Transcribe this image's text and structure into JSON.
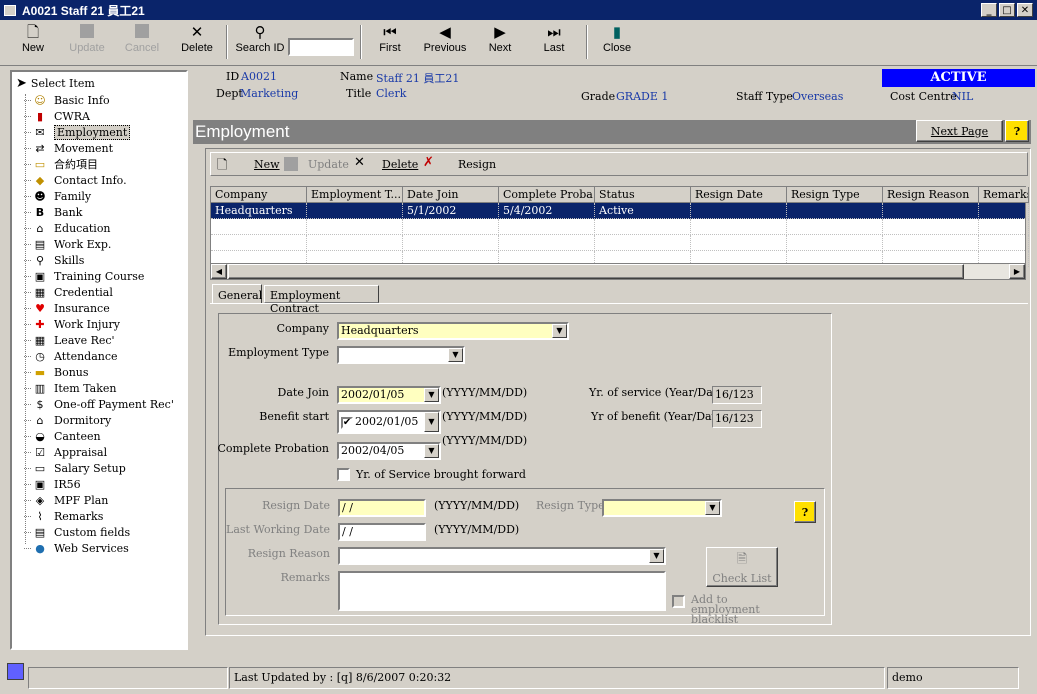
{
  "window": {
    "title": "A0021 Staff 21 員工21",
    "min": "_",
    "max": "□",
    "close": "✕"
  },
  "toolbar": {
    "new": "New",
    "update": "Update",
    "cancel": "Cancel",
    "delete": "Delete",
    "search_id": "Search ID",
    "search_value": "",
    "first": "First",
    "previous": "Previous",
    "next": "Next",
    "last": "Last",
    "close": "Close"
  },
  "sidebar": {
    "header": "Select Item",
    "items": [
      {
        "label": "Basic Info",
        "icon": "person-icon"
      },
      {
        "label": "CWRA",
        "icon": "book-icon"
      },
      {
        "label": "Employment",
        "icon": "envelope-icon"
      },
      {
        "label": "Movement",
        "icon": "move-icon"
      },
      {
        "label": "合約項目",
        "icon": "folder-icon"
      },
      {
        "label": "Contact Info.",
        "icon": "contact-icon"
      },
      {
        "label": "Family",
        "icon": "family-icon"
      },
      {
        "label": "Bank",
        "icon": "bank-icon"
      },
      {
        "label": "Education",
        "icon": "education-icon"
      },
      {
        "label": "Work Exp.",
        "icon": "document-icon"
      },
      {
        "label": "Skills",
        "icon": "skills-icon"
      },
      {
        "label": "Training Course",
        "icon": "training-icon"
      },
      {
        "label": "Credential",
        "icon": "credential-icon"
      },
      {
        "label": "Insurance",
        "icon": "heart-icon"
      },
      {
        "label": "Work Injury",
        "icon": "injury-icon"
      },
      {
        "label": "Leave Rec'",
        "icon": "calendar-icon"
      },
      {
        "label": "Attendance",
        "icon": "clock-icon"
      },
      {
        "label": "Bonus",
        "icon": "bonus-icon"
      },
      {
        "label": "Item Taken",
        "icon": "item-icon"
      },
      {
        "label": "One-off Payment Rec'",
        "icon": "dollar-icon"
      },
      {
        "label": "Dormitory",
        "icon": "dormitory-icon"
      },
      {
        "label": "Canteen",
        "icon": "canteen-icon"
      },
      {
        "label": "Appraisal",
        "icon": "checkbox-icon"
      },
      {
        "label": "Salary Setup",
        "icon": "salary-icon"
      },
      {
        "label": "IR56",
        "icon": "disk-icon"
      },
      {
        "label": "MPF Plan",
        "icon": "plan-icon"
      },
      {
        "label": "Remarks",
        "icon": "paperclip-icon"
      },
      {
        "label": "Custom fields",
        "icon": "custom-icon"
      },
      {
        "label": "Web Services",
        "icon": "globe-icon"
      }
    ]
  },
  "staff": {
    "id_label": "ID",
    "id": "A0021",
    "dept_label": "Dept",
    "dept": "Marketing",
    "name_label": "Name",
    "name": "Staff 21 員工21",
    "title_label": "Title",
    "title": "Clerk",
    "grade_label": "Grade",
    "grade": "GRADE 1",
    "staff_type_label": "Staff Type",
    "staff_type": "Overseas",
    "cost_centre_label": "Cost Centre",
    "cost_centre": "NIL",
    "status": "ACTIVE"
  },
  "section": {
    "title": "Employment",
    "next_page": "Next Page",
    "help": "?"
  },
  "subtoolbar": {
    "new": "New",
    "update": "Update",
    "delete": "Delete",
    "resign": "Resign"
  },
  "grid": {
    "columns": [
      "Company",
      "Employment T...",
      "Date Join",
      "Complete Proba...",
      "Status",
      "Resign Date",
      "Resign Type",
      "Resign Reason",
      "Remarks"
    ],
    "rows": [
      [
        "Headquarters",
        "",
        "5/1/2002",
        "5/4/2002",
        "Active",
        "",
        "",
        "",
        ""
      ]
    ]
  },
  "tabs": {
    "general": "General",
    "contract": "Employment Contract"
  },
  "form": {
    "company_label": "Company",
    "company": "Headquarters",
    "employment_type_label": "Employment Type",
    "employment_type": "",
    "date_join_label": "Date Join",
    "date_join": "2002/01/05",
    "benefit_start_label": "Benefit start",
    "benefit_start": "2002/01/05",
    "complete_probation_label": "Complete Probation",
    "complete_probation": "2002/04/05",
    "date_format": "(YYYY/MM/DD)",
    "yr_service_label": "Yr. of service (Year/Day)",
    "yr_service": "16/123",
    "yr_benefit_label": "Yr of benefit (Year/Day)",
    "yr_benefit": "16/123",
    "brought_forward_label": "Yr. of Service brought forward",
    "resign_date_label": "Resign Date",
    "resign_date": " / /",
    "last_working_label": "Last Working Date",
    "last_working": " / /",
    "resign_type_label": "Resign Type",
    "resign_type": "",
    "resign_reason_label": "Resign Reason",
    "resign_reason": "",
    "remarks_label": "Remarks",
    "remarks": "",
    "check_list": "Check List",
    "blacklist_label": "Add to employment blacklist"
  },
  "statusbar": {
    "last_updated": "Last Updated by : [q]  8/6/2007 0:20:32",
    "user": "demo"
  }
}
